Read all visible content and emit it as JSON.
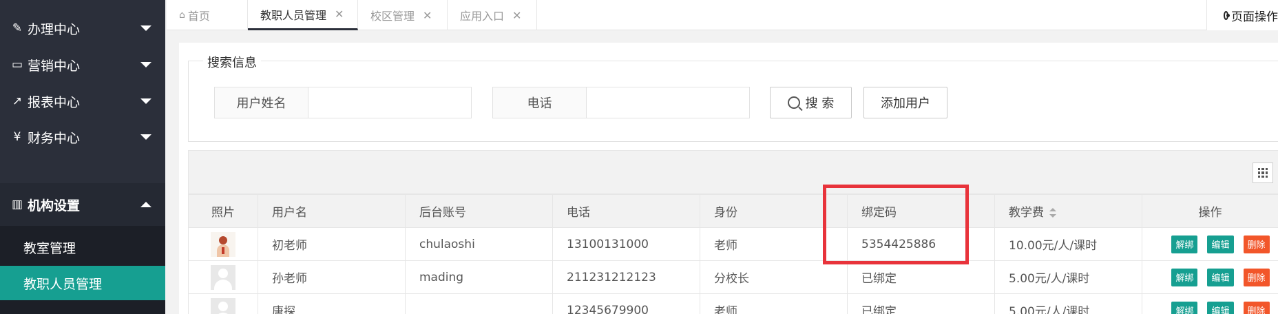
{
  "sidebar": {
    "menus": [
      {
        "icon": "edit-icon",
        "label": "办理中心"
      },
      {
        "icon": "laptop-icon",
        "label": "营销中心"
      },
      {
        "icon": "line-chart-icon",
        "label": "报表中心"
      },
      {
        "icon": "yen-icon",
        "label": "财务中心"
      },
      {
        "icon": "bank-icon",
        "label": "机构设置"
      }
    ],
    "submenu": [
      {
        "label": "教室管理"
      },
      {
        "label": "教职人员管理"
      }
    ]
  },
  "tabs": [
    {
      "label": "首页"
    },
    {
      "label": "教职人员管理"
    },
    {
      "label": "校区管理"
    },
    {
      "label": "应用入口"
    }
  ],
  "page_op": "页面操作",
  "search": {
    "legend": "搜索信息",
    "name_label": "用户姓名",
    "name_value": "",
    "phone_label": "电话",
    "phone_value": "",
    "search_button": "搜 索",
    "add_button": "添加用户"
  },
  "table": {
    "headers": [
      "照片",
      "用户名",
      "后台账号",
      "电话",
      "身份",
      "绑定码",
      "教学费",
      "操作"
    ],
    "rows": [
      {
        "username": "初老师",
        "account": "chulaoshi",
        "phone": "13100131000",
        "role": "老师",
        "bindcode": "5354425886",
        "fee": "10.00元/人/课时"
      },
      {
        "username": "孙老师",
        "account": "mading",
        "phone": "211231212123",
        "role": "分校长",
        "bindcode": "已绑定",
        "fee": "5.00元/人/课时"
      },
      {
        "username": "唐探",
        "account": "",
        "phone": "12345679900",
        "role": "老师",
        "bindcode": "已绑定",
        "fee": "5.00元/人/课时"
      }
    ],
    "actions": {
      "unbind": "解绑",
      "edit": "编辑",
      "delete": "删除"
    }
  },
  "colors": {
    "sidebar_bg": "#2b2f3a",
    "active_teal": "#169f91",
    "delete_orange": "#f2562a",
    "highlight_red": "#e8333b"
  }
}
